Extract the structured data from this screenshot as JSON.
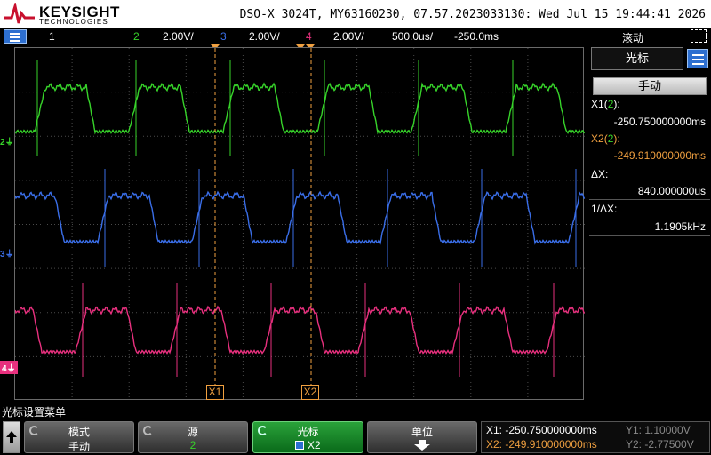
{
  "header": {
    "brand": "KEYSIGHT",
    "brand_sub": "TECHNOLOGIES",
    "title": "DSO-X 3024T, MY63160230, 07.57.2023033130: Wed Jul 15 19:44:41 2026"
  },
  "statusbar": {
    "ch1": "1",
    "ch2": "2",
    "ch2_scale": "2.00V/",
    "ch3": "3",
    "ch3_scale": "2.00V/",
    "ch4": "4",
    "ch4_scale": "2.00V/",
    "timebase": "500.0us/",
    "delay": "-250.0ms",
    "acq_mode": "滚动"
  },
  "colors": {
    "ch2": "#37d42a",
    "ch3": "#3a6ee8",
    "ch4": "#e8307e",
    "cursor": "#f0a040",
    "grid": "#4a4a4a"
  },
  "channel_markers": {
    "ch2": "2",
    "ch3": "3",
    "ch4": "4"
  },
  "cursors": {
    "x1_label": "X1",
    "x2_label": "X2"
  },
  "panel": {
    "title": "光标",
    "mode": "手动",
    "x1_label": "X1",
    "x1_src": "2",
    "x1_value": "-250.750000000ms",
    "x2_label": "X2",
    "x2_src": "2",
    "x2_value": "-249.910000000ms",
    "dx_label": "ΔX:",
    "dx_value": "840.000000us",
    "inv_dx_label": "1/ΔX:",
    "inv_dx_value": "1.1905kHz"
  },
  "softkeys": {
    "menu_title": "光标设置菜单",
    "mode_label": "模式",
    "mode_value": "手动",
    "source_label": "源",
    "source_value": "2",
    "cursor_label": "光标",
    "cursor_value": "X2",
    "units_label": "单位"
  },
  "readout": {
    "x1": "X1: -250.750000000ms",
    "x2": "X2: -249.910000000ms",
    "y1": "Y1: 1.10000V",
    "y2": "Y2: -2.77500V"
  }
}
